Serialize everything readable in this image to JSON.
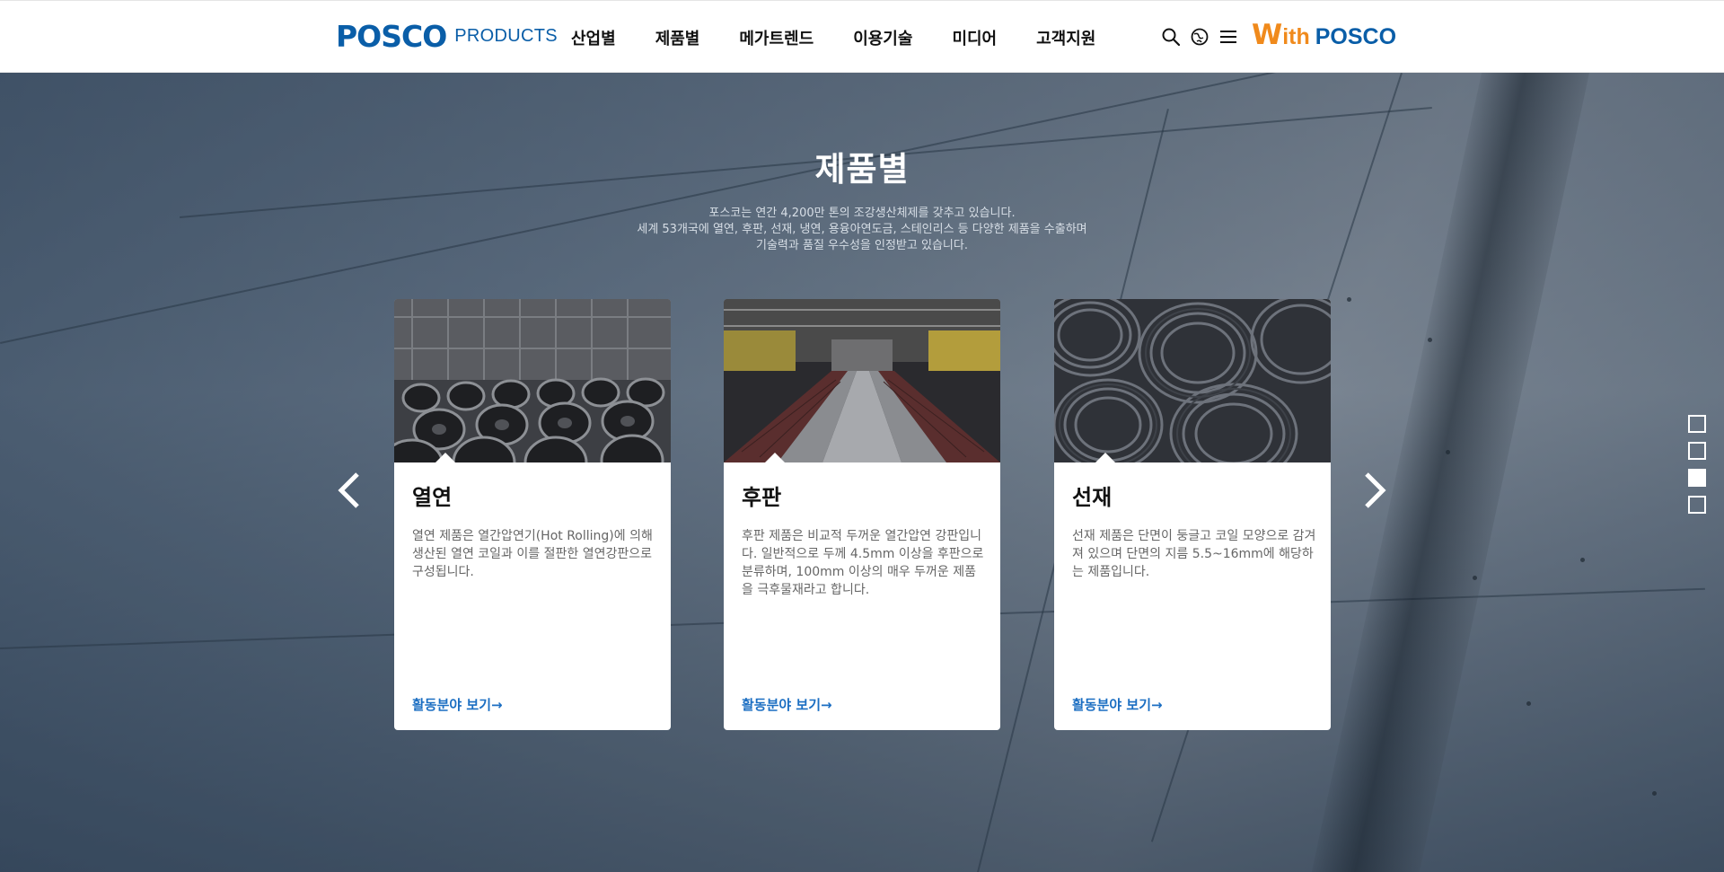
{
  "header": {
    "logo_main": "POSCO",
    "logo_sub": "PRODUCTS",
    "nav": [
      {
        "label": "산업별"
      },
      {
        "label": "제품별"
      },
      {
        "label": "메가트렌드"
      },
      {
        "label": "이용기술"
      },
      {
        "label": "미디어"
      },
      {
        "label": "고객지원"
      }
    ],
    "utility_icons": [
      "search-icon",
      "globe-icon",
      "menu-icon"
    ],
    "brand_w": "W",
    "brand_ith": "ith",
    "brand_posco": "POSCO"
  },
  "hero": {
    "title": "제품별",
    "description_lines": [
      "포스코는 연간 4,200만 톤의 조강생산체제를 갖추고 있습니다.",
      "세계 53개국에 열연, 후판, 선재, 냉연, 용융아연도금, 스테인리스 등 다양한 제품을 수출하며",
      "기술력과 품질 우수성을 인정받고 있습니다."
    ]
  },
  "cards": [
    {
      "title": "열연",
      "text": "열연 제품은 열간압연기(Hot Rolling)에 의해 생산된 열연 코일과 이를 절판한 열연강판으로 구성됩니다.",
      "link": "활동분야 보기→"
    },
    {
      "title": "후판",
      "text": "후판 제품은 비교적 두꺼운 열간압연 강판입니다. 일반적으로 두께 4.5mm 이상을 후판으로 분류하며, 100mm 이상의 매우 두꺼운 제품을 극후물재라고 합니다.",
      "link": "활동분야 보기→"
    },
    {
      "title": "선재",
      "text": "선재 제품은 단면이 둥글고 코일 모양으로 감겨져 있으며 단면의 지름 5.5~16mm에 해당하는 제품입니다.",
      "link": "활동분야 보기→"
    }
  ],
  "carousel": {
    "prev_icon": "chevron-left-icon",
    "next_icon": "chevron-right-icon"
  },
  "pager": {
    "count": 4,
    "active_index": 2
  },
  "colors": {
    "brand_blue": "#0a5ea8",
    "brand_orange": "#f08a1c",
    "link_blue": "#1b6ec2"
  }
}
